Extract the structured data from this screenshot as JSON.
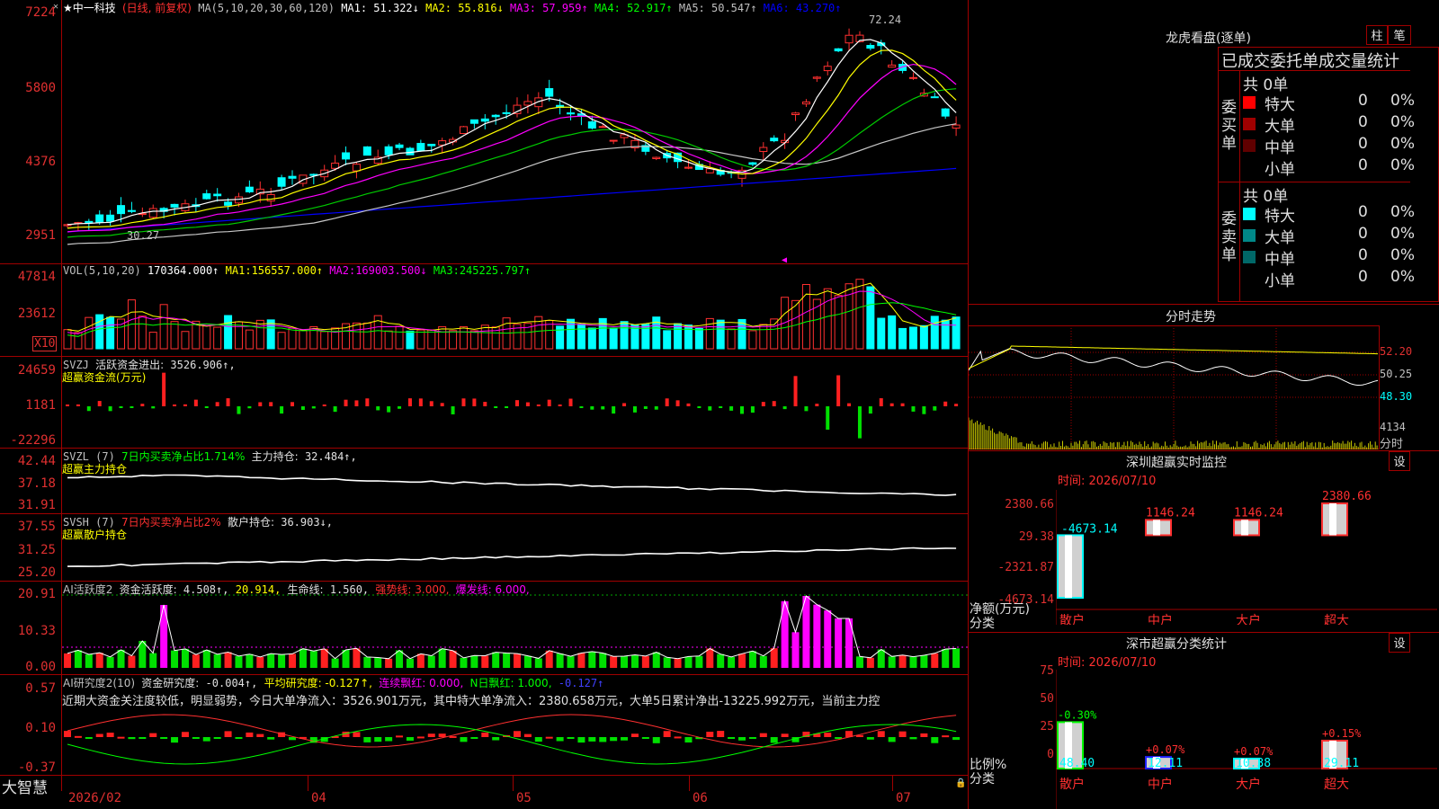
{
  "app": {
    "name": "大智慧",
    "stock_name": "★中一科技",
    "period": "(日线, 前复权)"
  },
  "main_chart": {
    "ma_header": "MA(5,10,20,30,60,120)",
    "ma_values": [
      {
        "label": "MA1:",
        "value": "51.322↓",
        "color": "#ffffff"
      },
      {
        "label": "MA2:",
        "value": "55.816↓",
        "color": "#ffff00"
      },
      {
        "label": "MA3:",
        "value": "57.959↑",
        "color": "#ff00ff"
      },
      {
        "label": "MA4:",
        "value": "52.917↑",
        "color": "#00ff00"
      },
      {
        "label": "MA5:",
        "value": "50.547↑",
        "color": "#c0c0c0"
      },
      {
        "label": "MA6:",
        "value": "43.270↑",
        "color": "#0000ff"
      }
    ],
    "y_labels": [
      "7224",
      "5800",
      "4376",
      "2951"
    ],
    "high_marker": "72.24",
    "low_marker": "30.27"
  },
  "volume": {
    "header": "VOL(5,10,20)",
    "vol_value": "170364.000↑",
    "ma1_label": "MA1:",
    "ma1": "156557.000↑",
    "ma2_label": "MA2:",
    "ma2": "169003.500↓",
    "ma3_label": "MA3:",
    "ma3": "245225.797↑",
    "y_labels": [
      "47814",
      "23612"
    ],
    "unit": "X10"
  },
  "svzj": {
    "header": "SVZJ",
    "label": "活跃资金进出:",
    "value": "3526.906↑,",
    "sub": "超赢资金流(万元)",
    "y_labels": [
      "24659",
      "1181",
      "-22296"
    ]
  },
  "svzl": {
    "header": "SVZL (7)",
    "desc": "7日内买卖净占比1.714%",
    "label": "主力持仓:",
    "value": "32.484↑,",
    "sub": "超赢主力持仓",
    "y_labels": [
      "42.44",
      "37.18",
      "31.91"
    ]
  },
  "svsh": {
    "header": "SVSH (7)",
    "desc": "7日内买卖净占比2%",
    "label": "散户持仓:",
    "value": "36.903↓,",
    "sub": "超赢散户持仓",
    "y_labels": [
      "37.55",
      "31.25",
      "25.20"
    ]
  },
  "ai_active": {
    "header": "AI活跃度2",
    "label": "资金活跃度:",
    "value": "4.508↑,",
    "v2": "20.914,",
    "life_label": "生命线:",
    "life": "1.560,",
    "strong": "强势线: 3.000,",
    "burst": "爆发线: 6.000,",
    "y_labels": [
      "20.91",
      "10.33",
      "0.00"
    ]
  },
  "ai_research": {
    "header": "AI研究度2(10)",
    "label": "资金研究度:",
    "value": "-0.004↑,",
    "avg": "平均研究度: -0.127↑,",
    "lianxu": "连续飘红: 0.000,",
    "nday": "N日飘红: 1.000,",
    "last": "-0.127↑",
    "summary": "近期大资金关注度较低，明显弱势，今日大单净流入：3526.901万元，其中特大单净流入：2380.658万元，大单5日累计净出-13225.992万元，当前主力控",
    "y_labels": [
      "0.57",
      "0.10",
      "-0.37"
    ]
  },
  "x_axis": [
    "2026/02",
    "04",
    "05",
    "06",
    "07"
  ],
  "right": {
    "dragon_title": "龙虎看盘(逐单)",
    "tab_col": "柱",
    "tab_pen": "笔",
    "order_title": "已成交委托单成交量统计",
    "buy_side": "委买单",
    "sell_side": "委卖单",
    "buy_total": "共 0单",
    "sell_total": "共 0单",
    "buy_rows": [
      {
        "label": "特大",
        "count": "0",
        "pct": "0%",
        "color": "#ff0000"
      },
      {
        "label": "大单",
        "count": "0",
        "pct": "0%",
        "color": "#a00000"
      },
      {
        "label": "中单",
        "count": "0",
        "pct": "0%",
        "color": "#600000"
      },
      {
        "label": "小单",
        "count": "0",
        "pct": "0%",
        "color": "#000000"
      }
    ],
    "sell_rows": [
      {
        "label": "特大",
        "count": "0",
        "pct": "0%",
        "color": "#00ffff"
      },
      {
        "label": "大单",
        "count": "0",
        "pct": "0%",
        "color": "#008888"
      },
      {
        "label": "中单",
        "count": "0",
        "pct": "0%",
        "color": "#006868"
      },
      {
        "label": "小单",
        "count": "0",
        "pct": "0%",
        "color": "#000000"
      }
    ],
    "intraday_title": "分时走势",
    "intraday_y": [
      "52.20",
      "50.25",
      "48.30"
    ],
    "intraday_vol": "4134",
    "intraday_vol_unit": "分时",
    "sz_monitor_title": "深圳超赢实时监控",
    "sz_settings": "设",
    "sz_time": "时间: 2026/07/10",
    "sz_y": [
      "2380.66",
      "29.38",
      "-2321.87",
      "-4673.14"
    ],
    "sz_axis_label": "净额(万元)",
    "sz_cat_label": "分类",
    "sz_bars": [
      {
        "cat": "散户",
        "value": -4673.14,
        "label": "-4673.14",
        "color": "#00ffff"
      },
      {
        "cat": "中户",
        "value": 1146.24,
        "label": "1146.24",
        "color": "#ff3030"
      },
      {
        "cat": "大户",
        "value": 1146.24,
        "label": "1146.24",
        "color": "#ff3030"
      },
      {
        "cat": "超大",
        "value": 2380.66,
        "label": "2380.66",
        "color": "#ff3030"
      }
    ],
    "stat_title": "深市超赢分类统计",
    "stat_settings": "设",
    "stat_time": "时间: 2026/07/10",
    "stat_y": [
      "75",
      "50",
      "25",
      "0"
    ],
    "stat_axis_label": "比例%",
    "stat_cat_label": "分类",
    "stat_bars": [
      {
        "cat": "散户",
        "value": 48.4,
        "label": "48.40",
        "delta": "-0.30%",
        "color": "#00ff00",
        "delta_color": "#00ff00"
      },
      {
        "cat": "中户",
        "value": 12.11,
        "label": "12.11",
        "delta": "+0.07%",
        "color": "#2020ff",
        "delta_color": "#ff3030"
      },
      {
        "cat": "大户",
        "value": 10.38,
        "label": "10.38",
        "delta": "+0.07%",
        "color": "#00ffff",
        "delta_color": "#ff3030"
      },
      {
        "cat": "超大",
        "value": 29.11,
        "label": "29.11",
        "delta": "+0.15%",
        "color": "#ff3030",
        "delta_color": "#ff3030"
      }
    ]
  }
}
